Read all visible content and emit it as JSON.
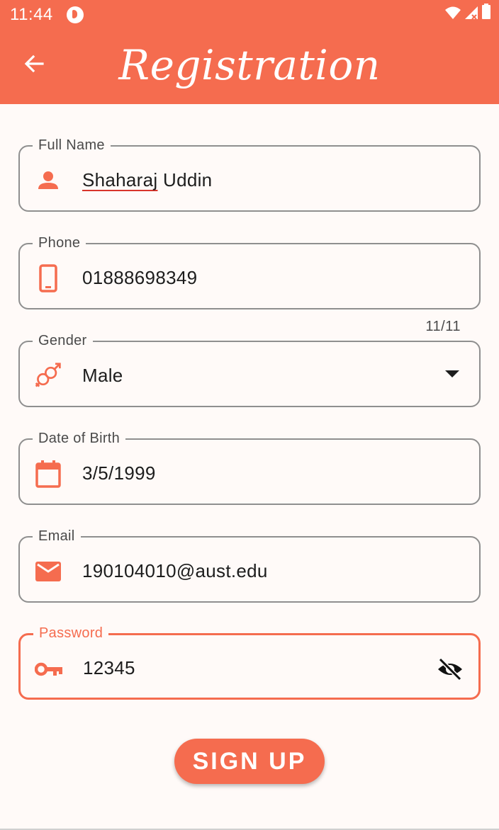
{
  "status_bar": {
    "time": "11:44",
    "icons": [
      "app-notification-icon",
      "wifi-icon",
      "signal-icon",
      "battery-icon"
    ]
  },
  "app_bar": {
    "title": "Registration",
    "back_icon": "arrow-back-icon"
  },
  "colors": {
    "accent": "#f56c4f",
    "border": "#8f8f8f",
    "background": "#fffaf8",
    "text": "#1d1d1d"
  },
  "form": {
    "full_name": {
      "label": "Full Name",
      "value_first": "Shaharaj",
      "value_rest": " Uddin",
      "icon": "person-icon"
    },
    "phone": {
      "label": "Phone",
      "value": "01888698349",
      "icon": "smartphone-icon",
      "counter": "11/11"
    },
    "gender": {
      "label": "Gender",
      "value": "Male",
      "icon": "gender-icon"
    },
    "dob": {
      "label": "Date of Birth",
      "value": "3/5/1999",
      "icon": "calendar-icon"
    },
    "email": {
      "label": "Email",
      "value": "190104010@aust.edu",
      "icon": "mail-icon"
    },
    "password": {
      "label": "Password",
      "value": "12345",
      "icon": "key-icon",
      "toggle_icon": "visibility-off-icon"
    }
  },
  "actions": {
    "signup_label": "SIGN UP"
  }
}
